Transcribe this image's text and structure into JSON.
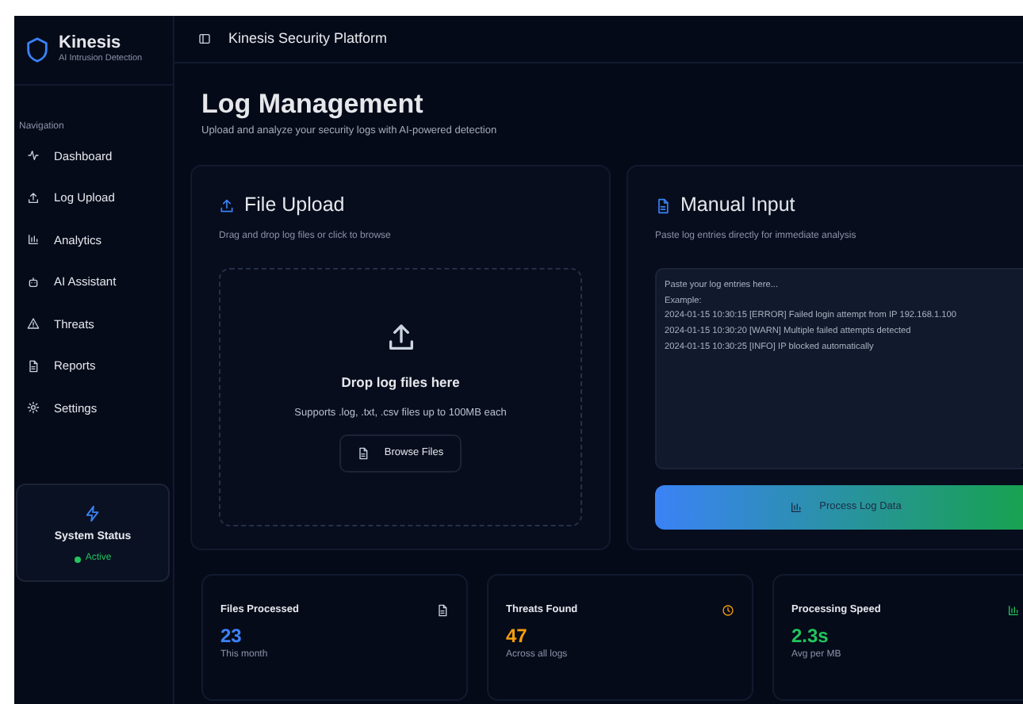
{
  "brand": {
    "name": "Kinesis",
    "tagline": "AI Intrusion Detection"
  },
  "sidebar": {
    "section": "Navigation",
    "items": [
      {
        "label": "Dashboard"
      },
      {
        "label": "Log Upload"
      },
      {
        "label": "Analytics"
      },
      {
        "label": "AI Assistant"
      },
      {
        "label": "Threats"
      },
      {
        "label": "Reports"
      },
      {
        "label": "Settings"
      }
    ],
    "status": {
      "title": "System Status",
      "state": "Active",
      "color": "#22c55e"
    }
  },
  "header": {
    "title": "Kinesis Security Platform"
  },
  "page": {
    "title": "Log Management",
    "subtitle": "Upload and analyze your security logs with AI-powered detection"
  },
  "upload": {
    "title": "File Upload",
    "subtitle": "Drag and drop log files or click to browse",
    "drop_title": "Drop log files here",
    "drop_hint": "Supports .log, .txt, .csv files up to 100MB each",
    "button": "Browse Files"
  },
  "manual": {
    "title": "Manual Input",
    "subtitle": "Paste log entries directly for immediate analysis",
    "placeholder": "Paste your log entries here...\nExample:\n2024-01-15 10:30:15 [ERROR] Failed login attempt from IP 192.168.1.100\n2024-01-15 10:30:20 [WARN] Multiple failed attempts detected\n2024-01-15 10:30:25 [INFO] IP blocked automatically",
    "button": "Process Log Data"
  },
  "stats": [
    {
      "label": "Files Processed",
      "value": "23",
      "note": "This month",
      "color": "#3b82f6"
    },
    {
      "label": "Threats Found",
      "value": "47",
      "note": "Across all logs",
      "color": "#f59e0b"
    },
    {
      "label": "Processing Speed",
      "value": "2.3s",
      "note": "Avg per MB",
      "color": "#22c55e"
    }
  ]
}
